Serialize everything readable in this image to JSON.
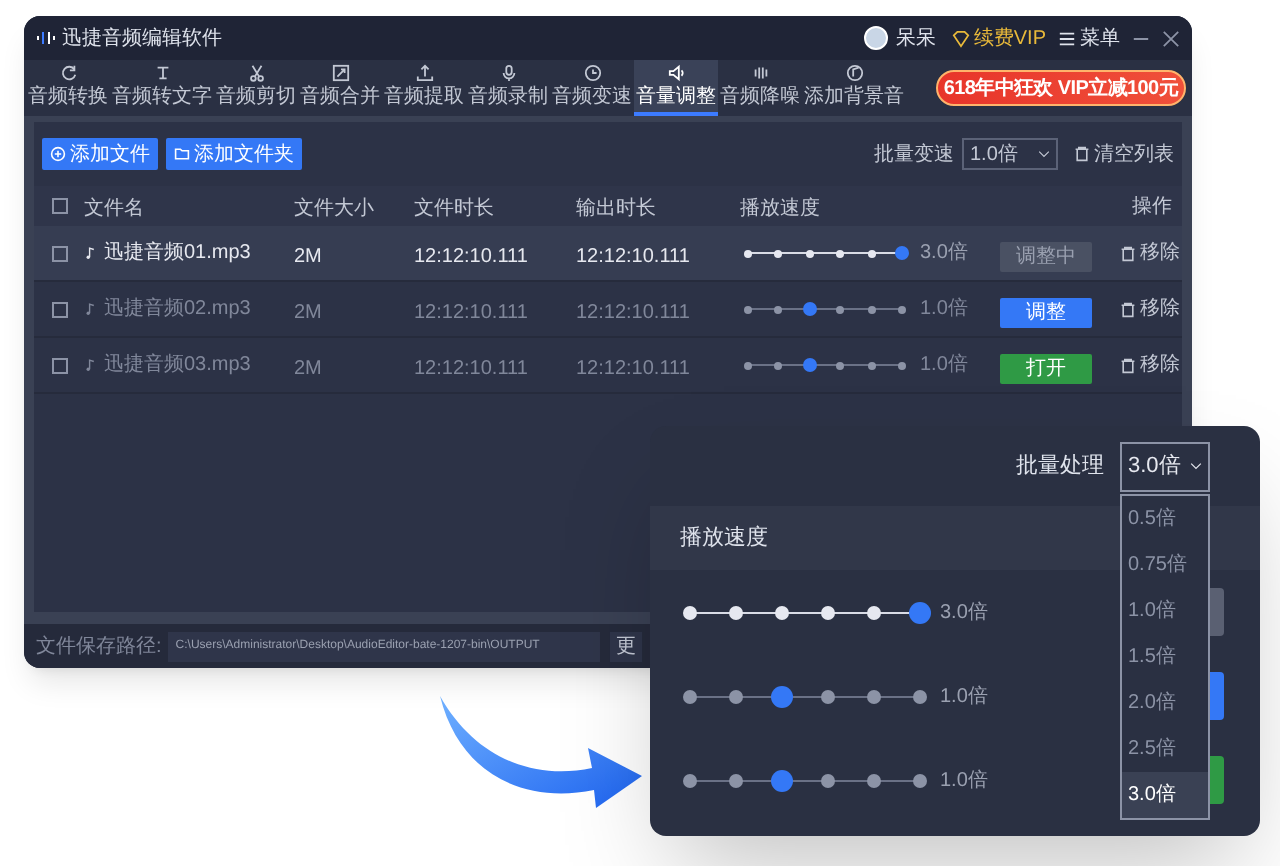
{
  "window": {
    "title": "迅捷音频编辑软件",
    "user": "呆呆",
    "vip": "续费VIP",
    "menu": "菜单"
  },
  "toolbar": {
    "tabs": [
      {
        "label": "音频转换",
        "selected": false
      },
      {
        "label": "音频转文字",
        "selected": false
      },
      {
        "label": "音频剪切",
        "selected": false
      },
      {
        "label": "音频合并",
        "selected": false
      },
      {
        "label": "音频提取",
        "selected": false
      },
      {
        "label": "音频录制",
        "selected": false
      },
      {
        "label": "音频变速",
        "selected": false
      },
      {
        "label": "音量调整",
        "selected": true
      },
      {
        "label": "音频降噪",
        "selected": false
      },
      {
        "label": "添加背景音",
        "selected": false
      }
    ],
    "promo": "618年中狂欢 VIP立减100元"
  },
  "actions": {
    "buttons": [
      "添加文件",
      "添加文件夹"
    ],
    "batch_label": "批量变速",
    "batch_value": "1.0倍",
    "clear": "清空列表"
  },
  "table": {
    "all_checked": false,
    "columns": [
      "文件名",
      "文件大小",
      "文件时长",
      "输出时长",
      "播放速度",
      "操作"
    ],
    "rows": [
      {
        "selected": true,
        "checked": false,
        "name": "迅捷音频01.mp3",
        "size": "2M",
        "duration": "12:12:10.111",
        "output": "12:12:10.111",
        "speed": {
          "level": 1,
          "reading": "3.0倍"
        },
        "action": {
          "kind": "busy",
          "label": "调整中"
        },
        "remove": "移除"
      },
      {
        "selected": false,
        "checked": false,
        "name": "迅捷音频02.mp3",
        "size": "2M",
        "duration": "12:12:10.111",
        "output": "12:12:10.111",
        "speed": {
          "level": 0.4,
          "reading": "1.0倍"
        },
        "action": {
          "kind": "adjust",
          "label": "调整"
        },
        "remove": "移除"
      },
      {
        "selected": false,
        "checked": false,
        "name": "迅捷音频03.mp3",
        "size": "2M",
        "duration": "12:12:10.111",
        "output": "12:12:10.111",
        "speed": {
          "level": 0.4,
          "reading": "1.0倍"
        },
        "action": {
          "kind": "open",
          "label": "打开"
        },
        "remove": "移除"
      }
    ]
  },
  "footer": {
    "label": "文件保存路径:",
    "path": "C:\\Users\\Administrator\\Desktop\\AudioEditor-bate-1207-bin\\OUTPUT",
    "button": "更"
  },
  "popup": {
    "label": "批量处理",
    "value": "3.0倍",
    "section": "播放速度",
    "options": [
      {
        "label": "0.5倍",
        "selected": false
      },
      {
        "label": "0.75倍",
        "selected": false
      },
      {
        "label": "1.0倍",
        "selected": false
      },
      {
        "label": "1.5倍",
        "selected": false
      },
      {
        "label": "2.0倍",
        "selected": false
      },
      {
        "label": "2.5倍",
        "selected": false
      },
      {
        "label": "3.0倍",
        "selected": true
      }
    ],
    "rows": [
      {
        "selected": true,
        "level": 1,
        "reading": "3.0倍",
        "kind": "busy"
      },
      {
        "selected": false,
        "level": 0.4,
        "reading": "1.0倍",
        "kind": "adjust"
      },
      {
        "selected": false,
        "level": 0.4,
        "reading": "1.0倍",
        "kind": "open"
      }
    ]
  }
}
